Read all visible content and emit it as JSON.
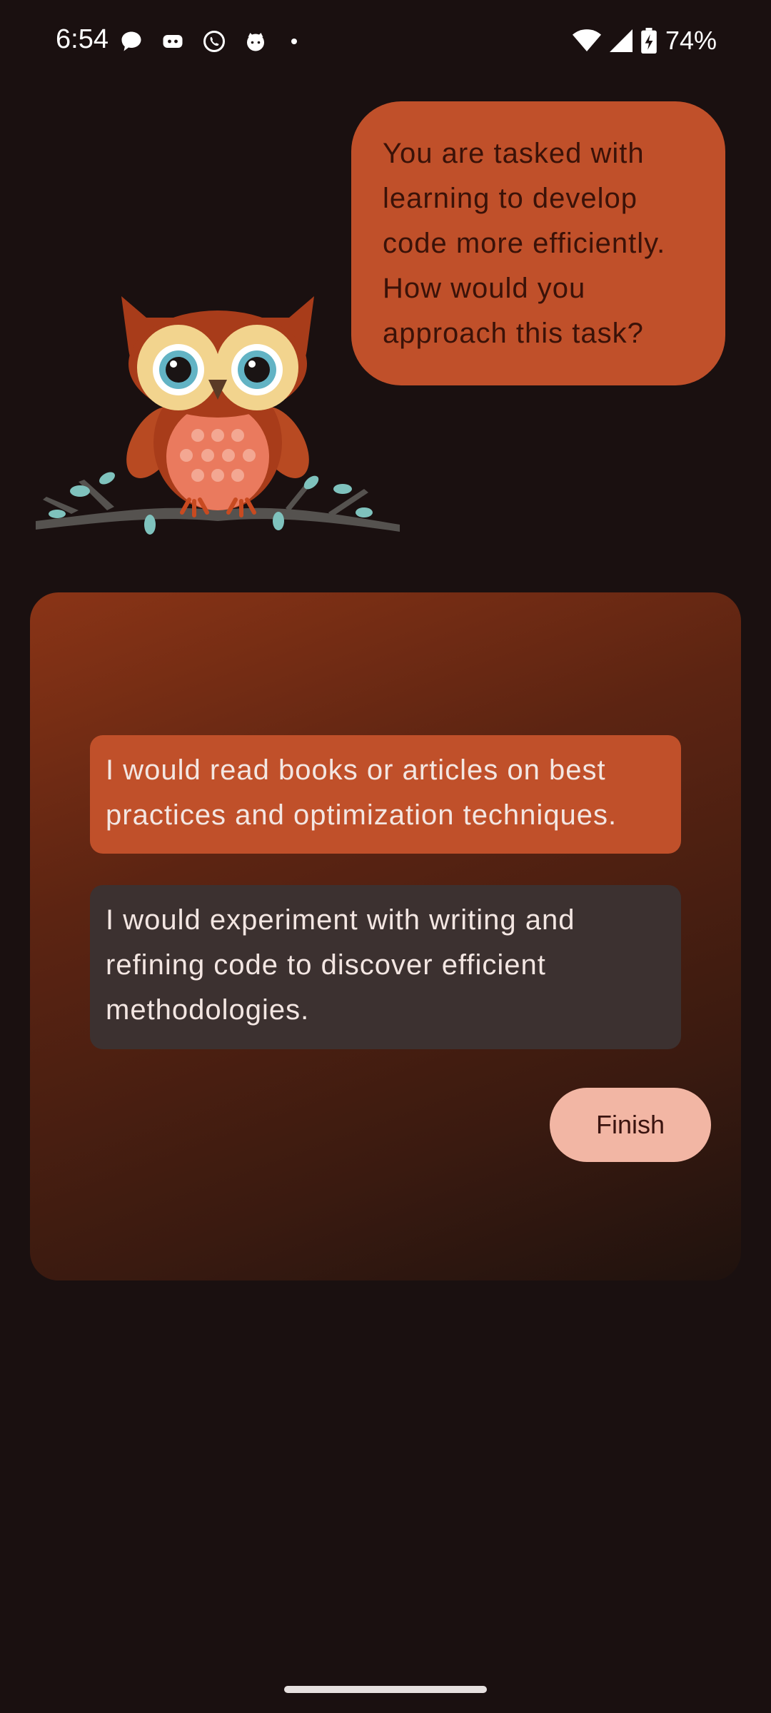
{
  "status_bar": {
    "time": "6:54",
    "battery": "74%",
    "notification_icons": [
      "message-bubble-icon",
      "discord-icon",
      "whatsapp-icon",
      "cat-face-icon",
      "more-dot-icon"
    ],
    "system_icons": [
      "wifi-icon",
      "signal-icon",
      "battery-charging-icon"
    ]
  },
  "prompt": {
    "text": "You are tasked with learning to develop code more efficiently. How would you approach this task?"
  },
  "options": [
    {
      "text": "I would read books or articles on best practices and optimization techniques.",
      "selected": true
    },
    {
      "text": "I would experiment with writing and refining code to discover efficient methodologies.",
      "selected": false
    }
  ],
  "actions": {
    "finish_label": "Finish"
  },
  "colors": {
    "background": "#1a1010",
    "accent": "#c0502a",
    "option_unselected": "#3c3130",
    "finish_button": "#f2b6a4"
  }
}
